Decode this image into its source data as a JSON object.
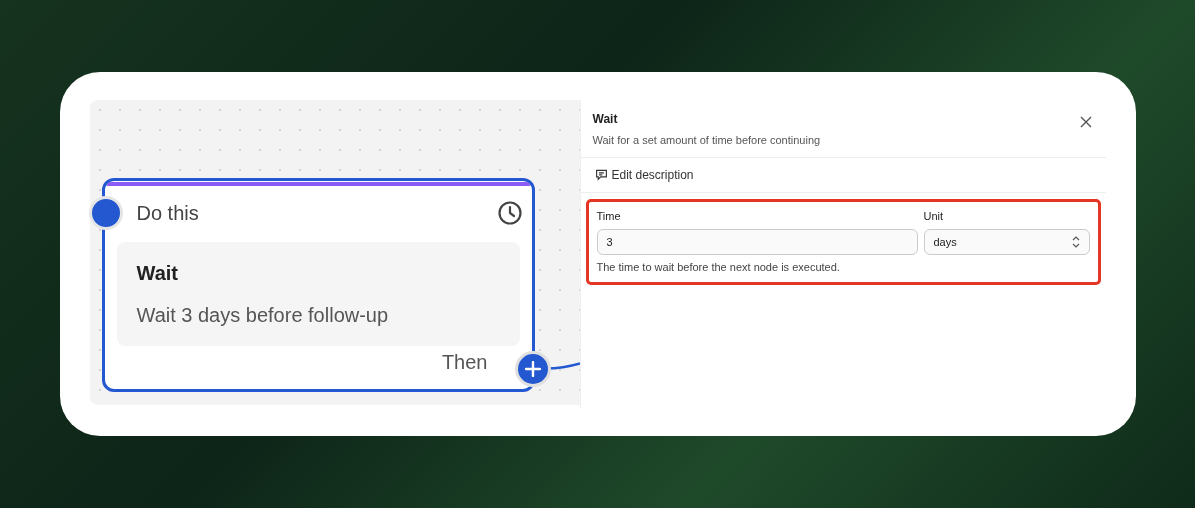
{
  "canvas": {
    "node": {
      "header": "Do this",
      "title": "Wait",
      "description": "Wait 3 days before follow-up",
      "footer": "Then",
      "selected": true
    }
  },
  "panel": {
    "title": "Wait",
    "subtitle": "Wait for a set amount of time before continuing",
    "edit_description": "Edit description",
    "highlighted": true,
    "time": {
      "label": "Time",
      "value": "3"
    },
    "unit": {
      "label": "Unit",
      "value": "days"
    },
    "help": "The time to wait before the next node is executed."
  }
}
